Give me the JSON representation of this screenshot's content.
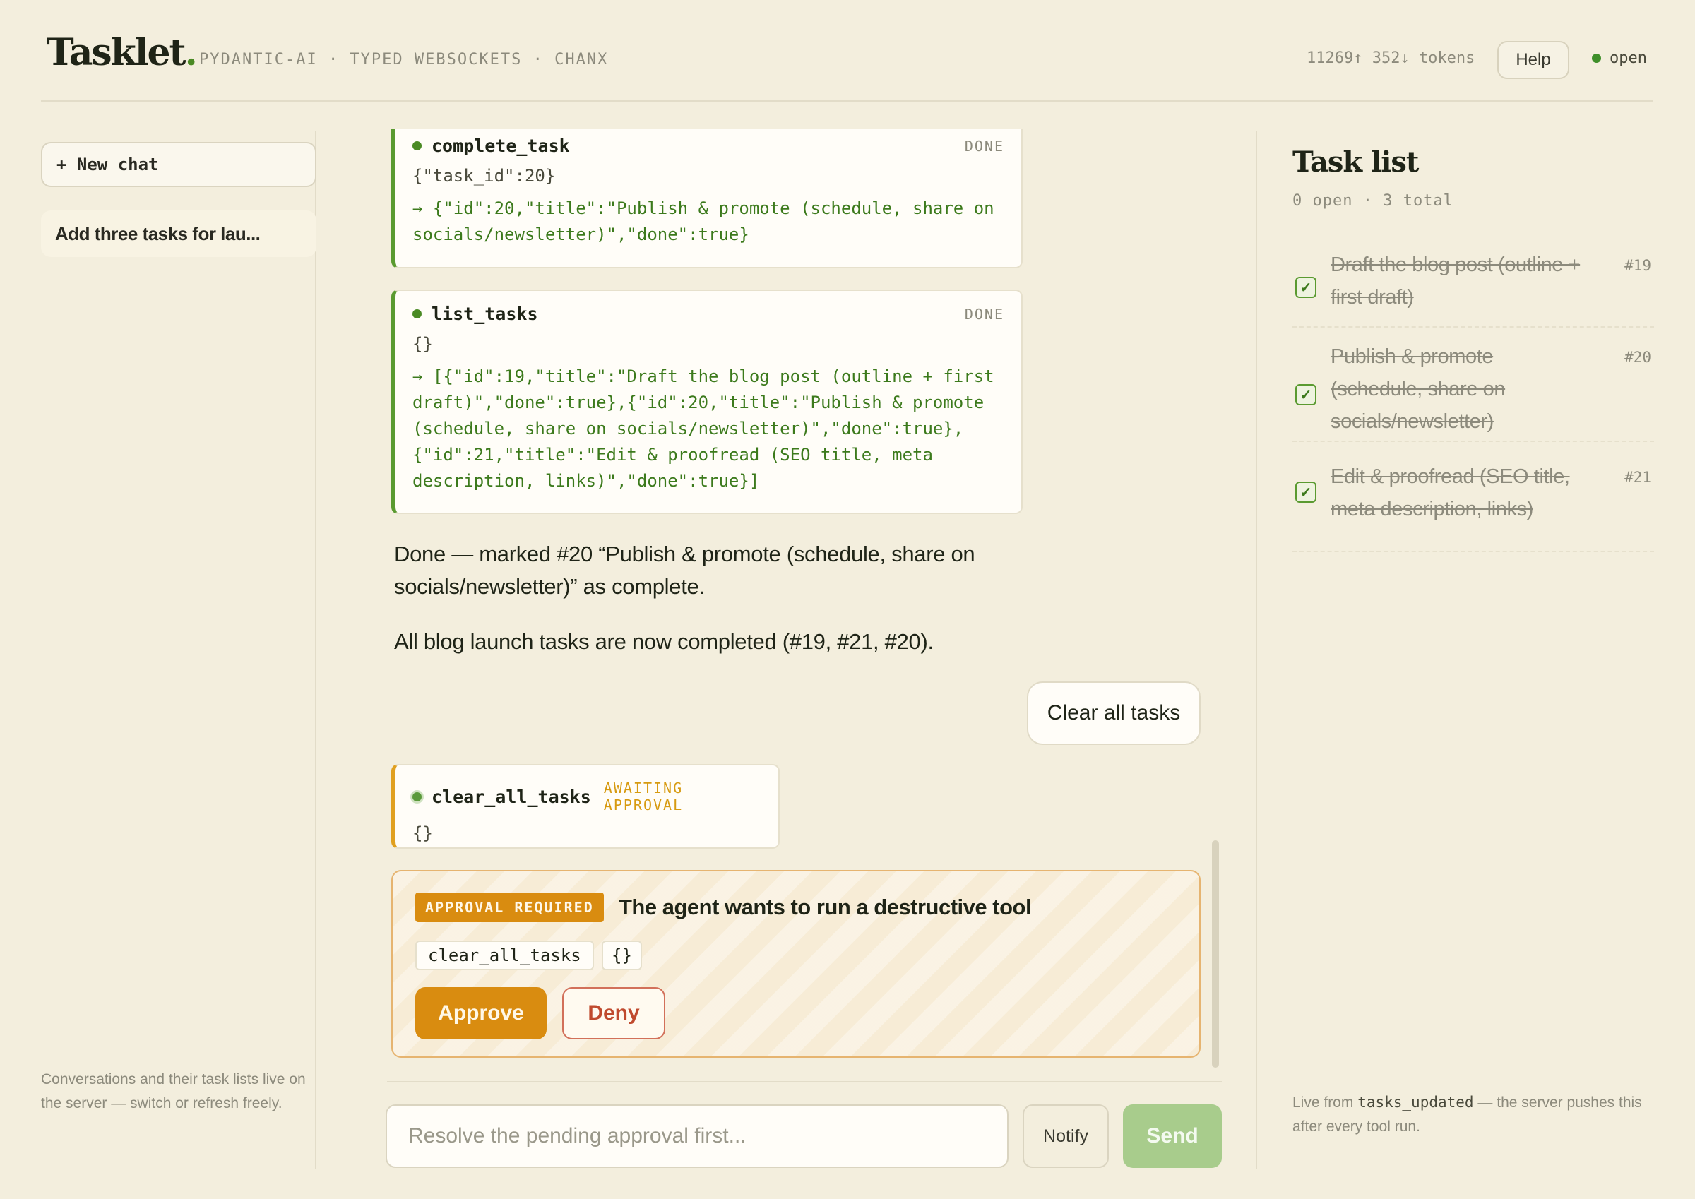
{
  "header": {
    "brand": "Tasklet",
    "brand_dot": ".",
    "tagline": "PYDANTIC-AI · TYPED WEBSOCKETS · CHANX",
    "tokens": "11269↑ 352↓ tokens",
    "help_label": "Help",
    "status_label": "open",
    "status_color": "#3f8f2a"
  },
  "sidebar": {
    "new_chat_label": "+ New chat",
    "chats": [
      {
        "label": "Add three tasks for lau..."
      }
    ],
    "footer_note": "Conversations and their task lists live on the server — switch or refresh freely."
  },
  "messages": {
    "tool_calls": [
      {
        "name": "complete_task",
        "state": "DONE",
        "args": "{\"task_id\":20}",
        "result": "→ {\"id\":20,\"title\":\"Publish & promote (schedule, share on socials/newsletter)\",\"done\":true}"
      },
      {
        "name": "list_tasks",
        "state": "DONE",
        "args": "{}",
        "result": "→ [{\"id\":19,\"title\":\"Draft the blog post (outline + first draft)\",\"done\":true},{\"id\":20,\"title\":\"Publish & promote (schedule, share on socials/newsletter)\",\"done\":true},{\"id\":21,\"title\":\"Edit & proofread (SEO title, meta description, links)\",\"done\":true}]"
      }
    ],
    "assistant_paragraph_1": "Done — marked #20 “Publish & promote (schedule, share on socials/newsletter)” as complete.",
    "assistant_paragraph_2": "All blog launch tasks are now completed (#19, #21, #20).",
    "user_message": "Clear all tasks",
    "pending_tool": {
      "name": "clear_all_tasks",
      "state": "AWAITING APPROVAL",
      "args": "{}"
    }
  },
  "approval": {
    "badge": "APPROVAL REQUIRED",
    "title": "The agent wants to run a destructive tool",
    "tool_name": "clear_all_tasks",
    "tool_args": "{}",
    "approve_label": "Approve",
    "deny_label": "Deny"
  },
  "composer": {
    "placeholder": "Resolve the pending approval first...",
    "notify_label": "Notify",
    "send_label": "Send"
  },
  "task_panel": {
    "title": "Task list",
    "summary": "0 open · 3 total",
    "tasks": [
      {
        "title": "Draft the blog post (outline + first draft)",
        "id": "#19",
        "done": true
      },
      {
        "title": "Publish & promote (schedule, share on socials/newsletter)",
        "id": "#20",
        "done": true
      },
      {
        "title": "Edit & proofread (SEO title, meta description, links)",
        "id": "#21",
        "done": true
      }
    ],
    "footer_prefix": "Live from ",
    "footer_code": "tasks_updated",
    "footer_suffix": " — the server pushes this after every tool run."
  },
  "colors": {
    "accent_green": "#4a8a24",
    "approval_orange": "#d98c10",
    "deny_red": "#c04a2e",
    "background": "#f3eedd"
  }
}
